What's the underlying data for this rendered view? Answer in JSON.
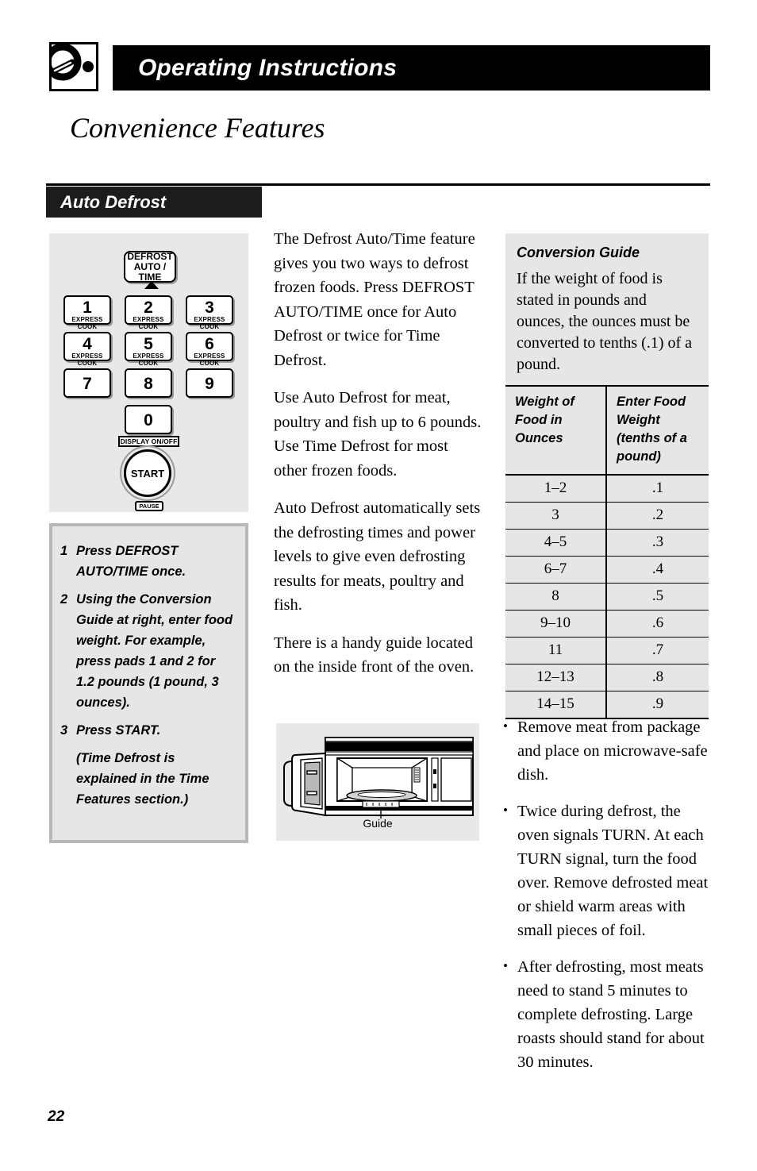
{
  "header": {
    "title": "Operating Instructions",
    "icon": "knob-dial-icon",
    "subtitle": "Convenience Features"
  },
  "section": {
    "title": "Auto Defrost"
  },
  "keypad": {
    "defrost_key": {
      "line1": "DEFROST",
      "line2": "AUTO / TIME"
    },
    "keys": [
      {
        "num": "1",
        "sub": "EXPRESS COOK"
      },
      {
        "num": "2",
        "sub": "EXPRESS COOK"
      },
      {
        "num": "3",
        "sub": "EXPRESS COOK"
      },
      {
        "num": "4",
        "sub": "EXPRESS COOK"
      },
      {
        "num": "5",
        "sub": "EXPRESS COOK"
      },
      {
        "num": "6",
        "sub": "EXPRESS COOK"
      },
      {
        "num": "7",
        "sub": ""
      },
      {
        "num": "8",
        "sub": ""
      },
      {
        "num": "9",
        "sub": ""
      }
    ],
    "zero_key": "0",
    "display_tag": "DISPLAY ON/OFF",
    "start_button": "START",
    "pause_tag": "PAUSE"
  },
  "steps": [
    {
      "number": "1",
      "text": "Press DEFROST AUTO/TIME once."
    },
    {
      "number": "2",
      "text": "Using the Conversion Guide at right, enter food weight. For example, press pads 1 and 2 for 1.2 pounds (1 pound, 3 ounces)."
    },
    {
      "number": "3",
      "text": "Press START."
    }
  ],
  "steps_note": "(Time Defrost is explained in the Time Features section.)",
  "body": {
    "paragraphs": [
      "The Defrost Auto/Time feature gives you two ways to defrost frozen foods. Press DEFROST AUTO/TIME once for Auto Defrost or twice for Time Defrost.",
      "Use Auto Defrost for meat, poultry and fish up to 6 pounds. Use Time Defrost for most other frozen foods.",
      "Auto Defrost automatically sets the defrosting times and power levels to give even defrosting results for meats, poultry and fish.",
      "There is a handy guide located on the inside front of the oven."
    ]
  },
  "figure": {
    "caption": "Guide",
    "name": "microwave-oven-open-door-illustration"
  },
  "conversion_guide": {
    "title": "Conversion Guide",
    "intro": "If the weight of food is stated in pounds and ounces, the ounces must be converted to tenths (.1) of a pound.",
    "columns": [
      "Weight of Food in Ounces",
      "Enter Food Weight (tenths of a pound)"
    ],
    "rows": [
      [
        "1–2",
        ".1"
      ],
      [
        "3",
        ".2"
      ],
      [
        "4–5",
        ".3"
      ],
      [
        "6–7",
        ".4"
      ],
      [
        "8",
        ".5"
      ],
      [
        "9–10",
        ".6"
      ],
      [
        "11",
        ".7"
      ],
      [
        "12–13",
        ".8"
      ],
      [
        "14–15",
        ".9"
      ]
    ]
  },
  "bullets": [
    "Remove meat from package and place on microwave-safe dish.",
    "Twice during defrost, the oven signals TURN. At each TURN signal, turn the food over. Remove defrosted meat or shield warm areas with small pieces of foil.",
    "After defrosting, most meats need to stand 5 minutes to complete defrosting. Large roasts should stand for about 30 minutes."
  ],
  "page_number": "22",
  "colors": {
    "header_bar": "#000000",
    "section_header": "#1c1c1c",
    "panel_gray": "#e8e8e8",
    "box_gray": "#e6e6e6",
    "box_border_gray": "#b8b8b8"
  }
}
